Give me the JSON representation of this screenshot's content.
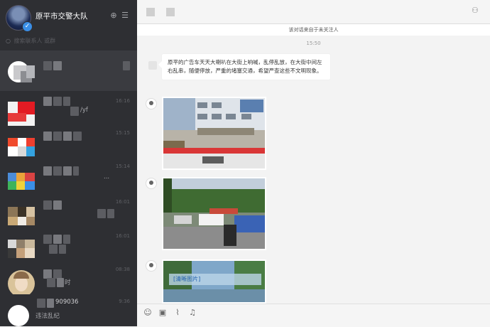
{
  "account": {
    "name": "原平市交警大队"
  },
  "search": {
    "placeholder": "搜索联系人 或群"
  },
  "conversations": [
    {
      "time": "",
      "text": ""
    },
    {
      "time": "16:16",
      "text": "/yf"
    },
    {
      "time": "15:15",
      "text": ""
    },
    {
      "time": "15:14",
      "text": "..."
    },
    {
      "time": "16:01",
      "text": ""
    },
    {
      "time": "16:01",
      "text": ""
    },
    {
      "time": "08:38",
      "text": "时"
    },
    {
      "time": "9:36",
      "text": "909036",
      "sub": "违法乱纪"
    }
  ],
  "notice": "该对话来自于未关注人",
  "timestamp": "15:50",
  "message": {
    "text": "原平的广告车天天大喇叭在大街上响喊，乱停乱放，在大街中间左右乱串，随便停放，严重的堵塞交通，希望严查这些不文明现象。"
  },
  "photo3_caption": "[清晰图片]",
  "colors": {
    "sidebar": "#2e2f33",
    "active": "#3a3b40",
    "accent": "#3a8ee6"
  }
}
